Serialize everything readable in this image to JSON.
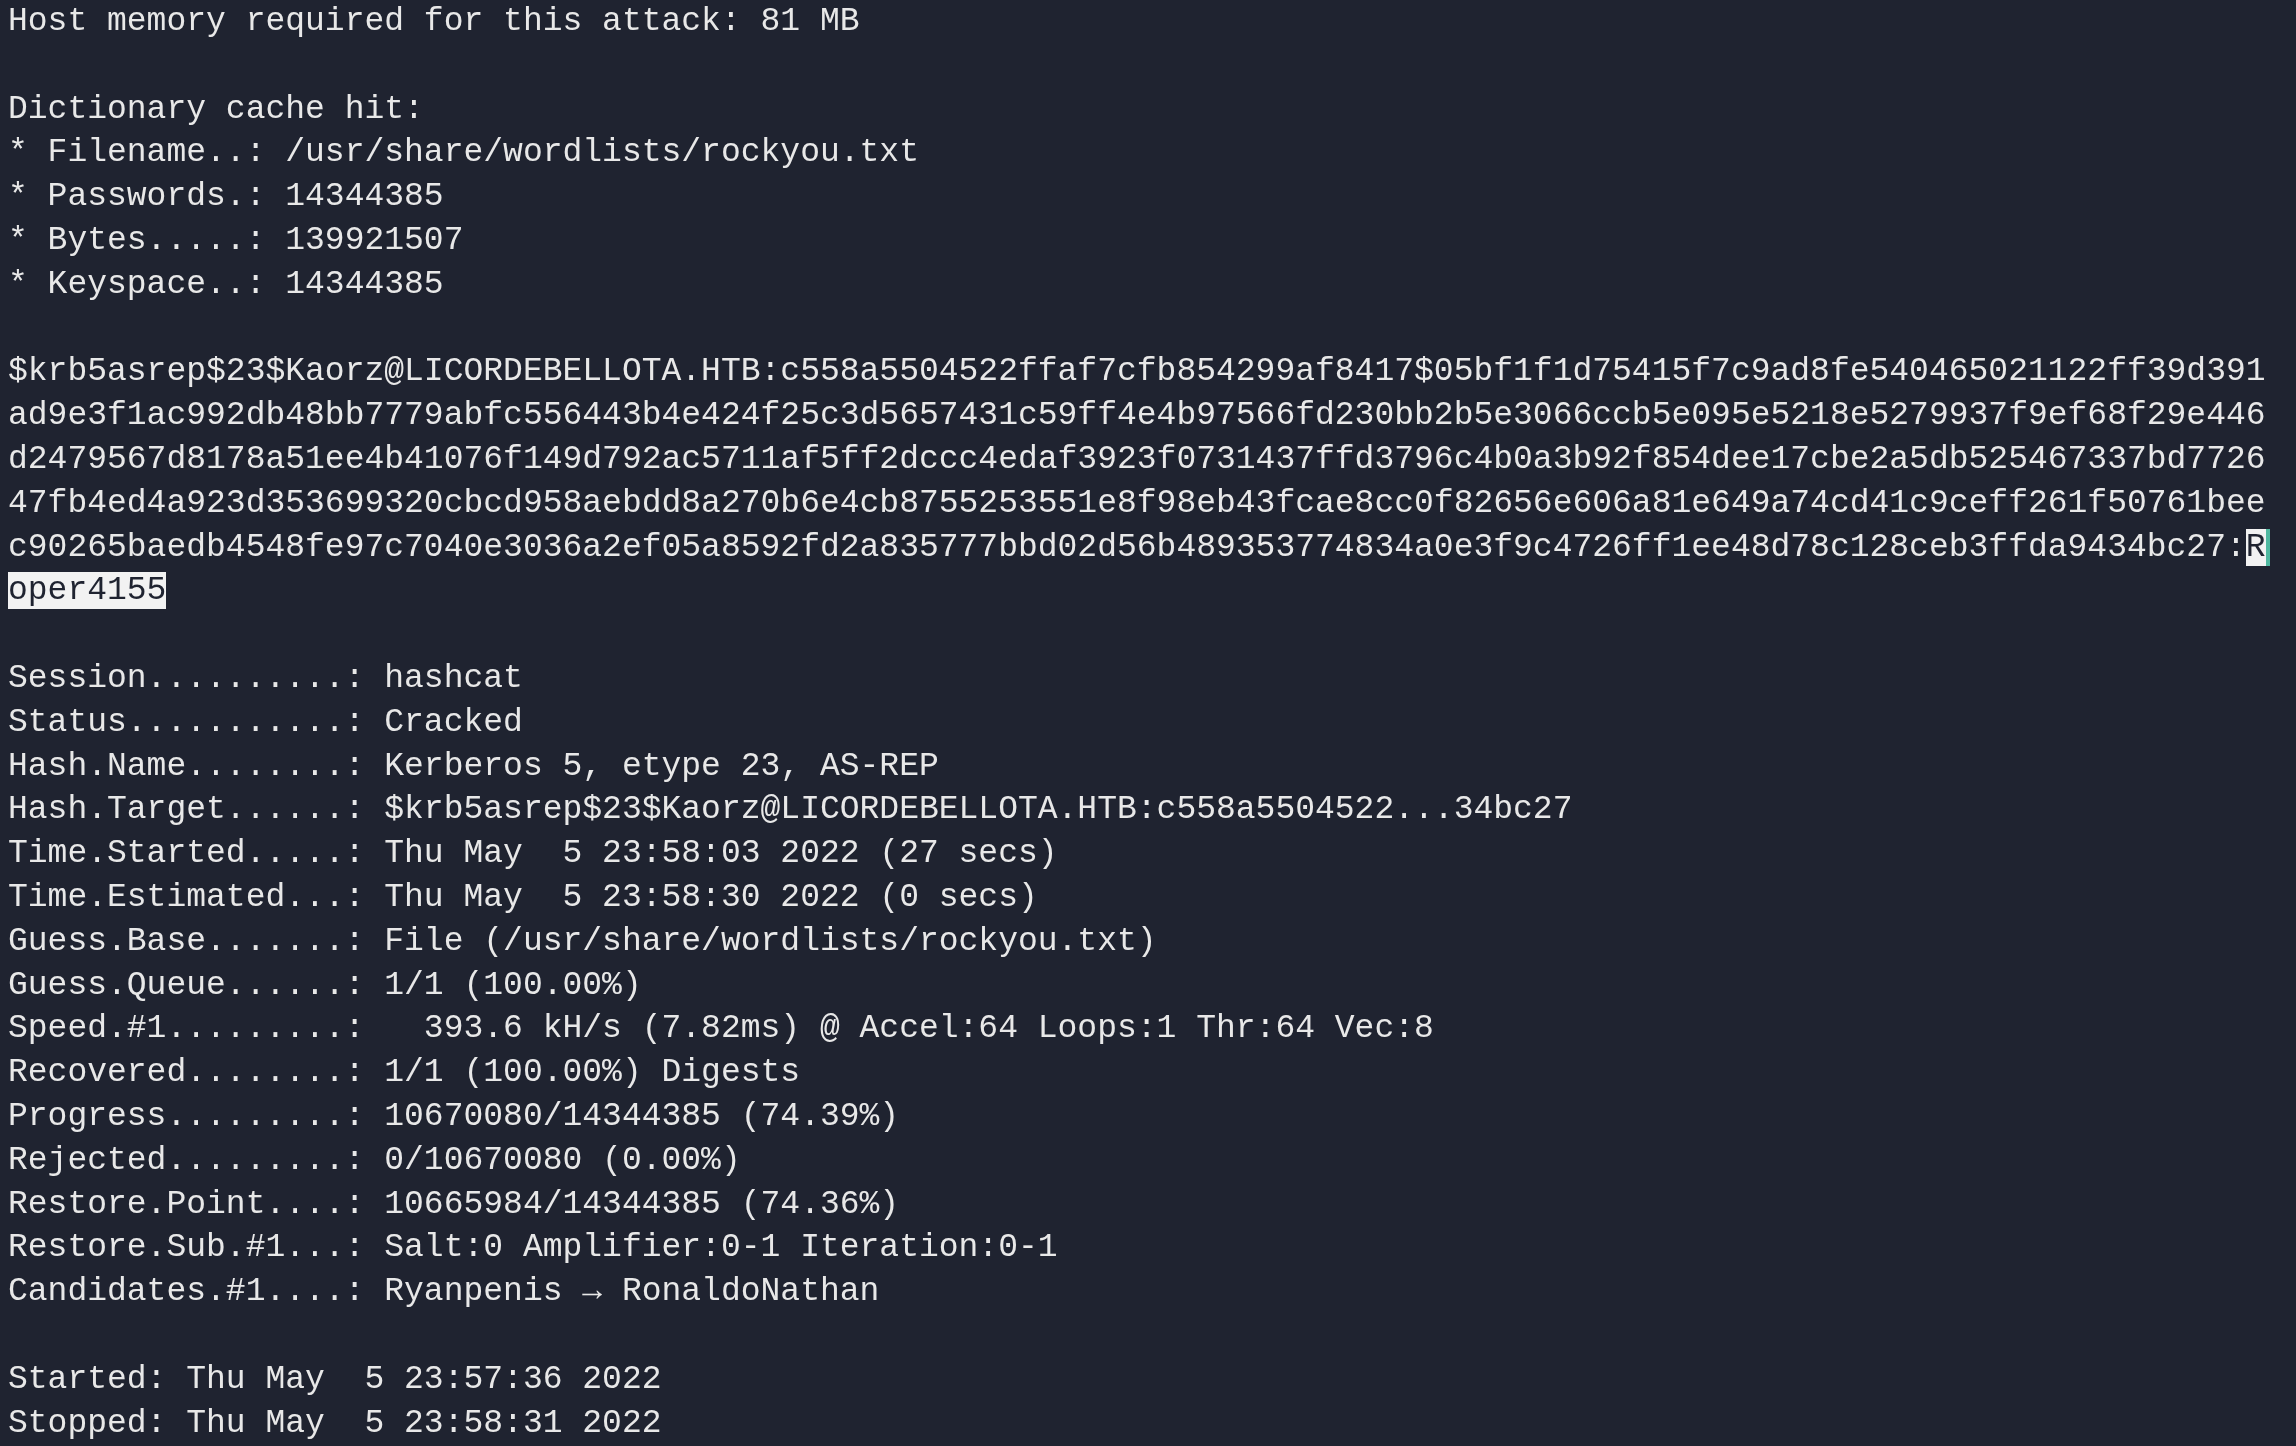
{
  "terminal": {
    "lines": [
      {
        "kind": "text",
        "segments": [
          {
            "text": "Host memory required for this attack: 81 MB",
            "selected": false
          }
        ]
      },
      {
        "kind": "blank"
      },
      {
        "kind": "text",
        "segments": [
          {
            "text": "Dictionary cache hit:",
            "selected": false
          }
        ]
      },
      {
        "kind": "text",
        "segments": [
          {
            "text": "* Filename..: /usr/share/wordlists/rockyou.txt",
            "selected": false
          }
        ]
      },
      {
        "kind": "text",
        "segments": [
          {
            "text": "* Passwords.: 14344385",
            "selected": false
          }
        ]
      },
      {
        "kind": "text",
        "segments": [
          {
            "text": "* Bytes.....: 139921507",
            "selected": false
          }
        ]
      },
      {
        "kind": "text",
        "segments": [
          {
            "text": "* Keyspace..: 14344385",
            "selected": false
          }
        ]
      },
      {
        "kind": "blank"
      },
      {
        "kind": "text",
        "segments": [
          {
            "text": "$krb5asrep$23$Kaorz@LICORDEBELLOTA.HTB:c558a5504522ffaf7cfb854299af8417$05bf1f1d75415f7c9ad8fe540465021122ff39d391",
            "selected": false
          }
        ]
      },
      {
        "kind": "text",
        "segments": [
          {
            "text": "ad9e3f1ac992db48bb7779abfc556443b4e424f25c3d5657431c59ff4e4b97566fd230bb2b5e3066ccb5e095e5218e5279937f9ef68f29e446",
            "selected": false
          }
        ]
      },
      {
        "kind": "text",
        "segments": [
          {
            "text": "d2479567d8178a51ee4b41076f149d792ac5711af5ff2dccc4edaf3923f0731437ffd3796c4b0a3b92f854dee17cbe2a5db525467337bd7726",
            "selected": false
          }
        ]
      },
      {
        "kind": "text",
        "segments": [
          {
            "text": "47fb4ed4a923d353699320cbcd958aebdd8a270b6e4cb8755253551e8f98eb43fcae8cc0f82656e606a81e649a74cd41c9ceff261f50761bee",
            "selected": false
          }
        ]
      },
      {
        "kind": "text",
        "segments": [
          {
            "text": "c90265baedb4548fe97c7040e3036a2ef05a8592fd2a835777bbd02d56b489353774834a0e3f9c4726ff1ee48d78c128ceb3ffda9434bc27:",
            "selected": false
          },
          {
            "text": "R",
            "selected": true
          }
        ]
      },
      {
        "kind": "text",
        "segments": [
          {
            "text": "oper4155",
            "selected": true
          }
        ]
      },
      {
        "kind": "blank"
      },
      {
        "kind": "text",
        "segments": [
          {
            "text": "Session..........: hashcat",
            "selected": false
          }
        ]
      },
      {
        "kind": "text",
        "segments": [
          {
            "text": "Status...........: Cracked",
            "selected": false
          }
        ]
      },
      {
        "kind": "text",
        "segments": [
          {
            "text": "Hash.Name........: Kerberos 5, etype 23, AS-REP",
            "selected": false
          }
        ]
      },
      {
        "kind": "text",
        "segments": [
          {
            "text": "Hash.Target......: $krb5asrep$23$Kaorz@LICORDEBELLOTA.HTB:c558a5504522...34bc27",
            "selected": false
          }
        ]
      },
      {
        "kind": "text",
        "segments": [
          {
            "text": "Time.Started.....: Thu May  5 23:58:03 2022 (27 secs)",
            "selected": false
          }
        ]
      },
      {
        "kind": "text",
        "segments": [
          {
            "text": "Time.Estimated...: Thu May  5 23:58:30 2022 (0 secs)",
            "selected": false
          }
        ]
      },
      {
        "kind": "text",
        "segments": [
          {
            "text": "Guess.Base.......: File (/usr/share/wordlists/rockyou.txt)",
            "selected": false
          }
        ]
      },
      {
        "kind": "text",
        "segments": [
          {
            "text": "Guess.Queue......: 1/1 (100.00%)",
            "selected": false
          }
        ]
      },
      {
        "kind": "text",
        "segments": [
          {
            "text": "Speed.#1.........:   393.6 kH/s (7.82ms) @ Accel:64 Loops:1 Thr:64 Vec:8",
            "selected": false
          }
        ]
      },
      {
        "kind": "text",
        "segments": [
          {
            "text": "Recovered........: 1/1 (100.00%) Digests",
            "selected": false
          }
        ]
      },
      {
        "kind": "text",
        "segments": [
          {
            "text": "Progress.........: 10670080/14344385 (74.39%)",
            "selected": false
          }
        ]
      },
      {
        "kind": "text",
        "segments": [
          {
            "text": "Rejected.........: 0/10670080 (0.00%)",
            "selected": false
          }
        ]
      },
      {
        "kind": "text",
        "segments": [
          {
            "text": "Restore.Point....: 10665984/14344385 (74.36%)",
            "selected": false
          }
        ]
      },
      {
        "kind": "text",
        "segments": [
          {
            "text": "Restore.Sub.#1...: Salt:0 Amplifier:0-1 Iteration:0-1",
            "selected": false
          }
        ]
      },
      {
        "kind": "text",
        "segments": [
          {
            "text": "Candidates.#1....: Ryanpenis → RonaldoNathan",
            "selected": false
          }
        ]
      },
      {
        "kind": "blank"
      },
      {
        "kind": "text",
        "segments": [
          {
            "text": "Started: Thu May  5 23:57:36 2022",
            "selected": false
          }
        ]
      },
      {
        "kind": "text",
        "segments": [
          {
            "text": "Stopped: Thu May  5 23:58:31 2022",
            "selected": false
          }
        ]
      }
    ]
  }
}
